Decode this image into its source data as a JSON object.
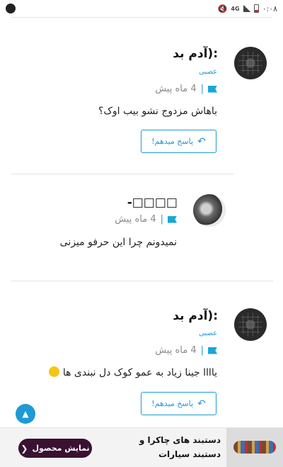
{
  "status_bar": {
    "time": "۰:۰۸",
    "network": "4G"
  },
  "comments": [
    {
      "name": "آدم بد):",
      "role": "عصبی",
      "time": "4 ماه پیش",
      "text": "باهاش مزدوج نشو بیب اوک؟",
      "reply_label": "پاسخ میدهم!"
    },
    {
      "name": "-□□□□",
      "time": "4 ماه پیش",
      "text": "نمیدونم چرا این حرفو میزنی"
    },
    {
      "name": "آدم بد):",
      "role": "عصبی",
      "time": "4 ماه پیش",
      "text": "یاااا جینا زیاد به عمو کوک دل نبندی ها",
      "reply_label": "پاسخ میدهم!"
    }
  ],
  "ad": {
    "title": "دستبند های چاکرا و دستبند سیارات",
    "button_label": "نمایش محصول"
  },
  "colors": {
    "accent": "#1e9ad6",
    "ad_button": "#3a1131"
  }
}
